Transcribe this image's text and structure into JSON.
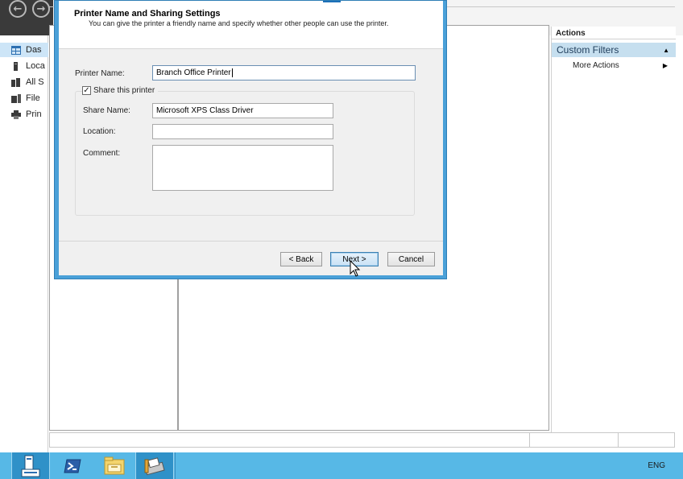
{
  "server_manager": {
    "nav_items": [
      {
        "label": "Das",
        "icon": "dashboard-icon"
      },
      {
        "label": "Loca",
        "icon": "server-icon"
      },
      {
        "label": "All S",
        "icon": "servers-icon"
      },
      {
        "label": "File",
        "icon": "file-services-icon"
      },
      {
        "label": "Prin",
        "icon": "printer-icon"
      }
    ],
    "actions": {
      "header": "Actions",
      "section": "Custom Filters",
      "more": "More Actions"
    }
  },
  "dialog": {
    "title": "Printer Name and Sharing Settings",
    "subtitle": "You can give the printer a friendly name and specify whether other people can use the printer.",
    "printer_name_label": "Printer Name:",
    "printer_name_value": "Branch Office Printer",
    "share_checkbox_label": "Share this printer",
    "share_checked": true,
    "share_name_label": "Share Name:",
    "share_name_value": "Microsoft XPS Class Driver",
    "location_label": "Location:",
    "location_value": "",
    "comment_label": "Comment:",
    "comment_value": "",
    "buttons": {
      "back": "< Back",
      "next": "Next >",
      "cancel": "Cancel"
    }
  },
  "taskbar": {
    "items": [
      "server-manager-icon",
      "powershell-icon",
      "file-explorer-icon",
      "print-management-icon"
    ],
    "language": "ENG"
  },
  "colors": {
    "dialog_border": "#4aa0d8",
    "taskbar": "#57b8e6",
    "actions_section": "#c6dfef"
  }
}
